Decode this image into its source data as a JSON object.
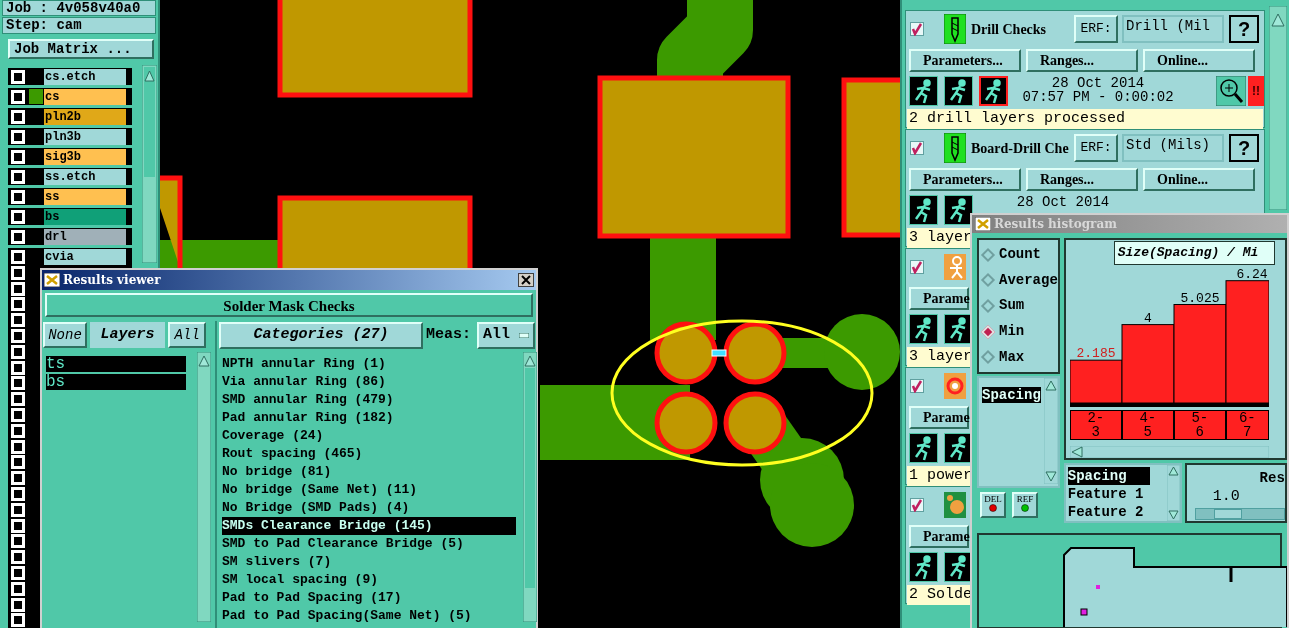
{
  "job_panel": {
    "job": "Job : 4v058v40a0",
    "step": "Step: cam",
    "matrix_button": "Job Matrix ...",
    "layers": [
      {
        "name": "cs.etch",
        "color": "#a0d8d8",
        "checked": false,
        "affected": false
      },
      {
        "name": "cs",
        "color": "#ffc050",
        "checked": false,
        "affected": true
      },
      {
        "name": "pln2b",
        "color": "#e0a818",
        "checked": false,
        "affected": false
      },
      {
        "name": "pln3b",
        "color": "#a0d8d8",
        "checked": false,
        "affected": false
      },
      {
        "name": "sig3b",
        "color": "#ffc050",
        "checked": false,
        "affected": false
      },
      {
        "name": "ss.etch",
        "color": "#a0d8d8",
        "checked": false,
        "affected": false
      },
      {
        "name": "ss",
        "color": "#ffc050",
        "checked": false,
        "affected": false
      },
      {
        "name": "bs",
        "color": "#10a078",
        "checked": false,
        "affected": false
      },
      {
        "name": "drl",
        "color": "#a0b0b8",
        "checked": false,
        "affected": false
      },
      {
        "name": "cvia",
        "color": "#a0d8d8",
        "checked": false,
        "affected": false
      }
    ],
    "empty_layers": [
      {
        "checked": false
      },
      {
        "checked": false
      },
      {
        "checked": false
      },
      {
        "checked": false
      },
      {
        "checked": false
      },
      {
        "checked": false
      },
      {
        "checked": false
      },
      {
        "checked": false
      },
      {
        "checked": false
      },
      {
        "checked": false
      },
      {
        "checked": false
      },
      {
        "checked": false
      },
      {
        "checked": false
      },
      {
        "checked": false
      },
      {
        "checked": false
      },
      {
        "checked": false
      },
      {
        "checked": false
      },
      {
        "checked": false
      },
      {
        "checked": false
      },
      {
        "checked": false
      },
      {
        "checked": false
      },
      {
        "checked": false
      },
      {
        "checked": false
      }
    ]
  },
  "checks_panel": {
    "checks": [
      {
        "enabled": true,
        "kind": "drill",
        "title": "Drill Checks",
        "erf_button": "ERF:",
        "erf_value": "Drill (Mil",
        "help_button": "?",
        "buttons": [
          "Parameters...",
          "Ranges...",
          "Online..."
        ],
        "date": "28 Oct 2014",
        "time": "07:57 PM - 0:00:02",
        "alert": "!!",
        "status": "2 drill layers processed"
      },
      {
        "enabled": true,
        "kind": "drill",
        "title": "Board-Drill Che",
        "erf_button": "ERF:",
        "erf_value": "Std (Mils)",
        "help_button": "?",
        "buttons": [
          "Parameters...",
          "Ranges...",
          "Online..."
        ],
        "date": "28 Oct 2014",
        "status": "3 layer"
      },
      {
        "enabled": true,
        "kind": "person",
        "buttons": [
          "Parame"
        ],
        "status": "3 layer"
      },
      {
        "enabled": true,
        "kind": "gear",
        "buttons": [
          "Parame"
        ],
        "status": "1 power"
      },
      {
        "enabled": true,
        "kind": "pads",
        "buttons": [
          "Parame"
        ],
        "status": "2 Solde"
      }
    ]
  },
  "results_viewer": {
    "title": "Results viewer",
    "check_set": "Solder Mask Checks",
    "layer_buttons": [
      "None",
      "Layers",
      "All"
    ],
    "layers": [
      {
        "name": "ts",
        "selected": true
      },
      {
        "name": "bs",
        "selected": true
      }
    ],
    "categories_button": "Categories (27)",
    "meas_label": "Meas:",
    "meas_value": "All",
    "categories": [
      {
        "label": "NPTH annular Ring (1)",
        "selected": false
      },
      {
        "label": "Via annular Ring (86)",
        "selected": false
      },
      {
        "label": "SMD annular Ring (479)",
        "selected": false
      },
      {
        "label": "Pad annular Ring (182)",
        "selected": false
      },
      {
        "label": "Coverage (24)",
        "selected": false
      },
      {
        "label": "Rout spacing (465)",
        "selected": false
      },
      {
        "label": "No bridge (81)",
        "selected": false
      },
      {
        "label": "No bridge (Same Net) (11)",
        "selected": false
      },
      {
        "label": "No Bridge (SMD Pads) (4)",
        "selected": false
      },
      {
        "label": "SMDs Clearance Bridge (145)",
        "selected": true
      },
      {
        "label": "SMD to Pad Clearance Bridge (5)",
        "selected": false
      },
      {
        "label": "SM slivers (7)",
        "selected": false
      },
      {
        "label": "SM local spacing (9)",
        "selected": false
      },
      {
        "label": "Pad to Pad Spacing (17)",
        "selected": false
      },
      {
        "label": "Pad to Pad Spacing(Same Net) (5)",
        "selected": false
      }
    ]
  },
  "histogram": {
    "title": "Results histogram",
    "modes": [
      {
        "label": "Count",
        "selected": false
      },
      {
        "label": "Average",
        "selected": false
      },
      {
        "label": "Sum",
        "selected": false
      },
      {
        "label": "Min",
        "selected": true
      },
      {
        "label": "Max",
        "selected": false
      }
    ],
    "measures": [
      {
        "label": "Spacing",
        "selected": true
      }
    ],
    "del_button": "DEL",
    "ref_button": "REF",
    "chart_data": {
      "type": "bar",
      "title": "Size(Spacing) / Mi",
      "categories": [
        "2-3",
        "4-5",
        "5-6",
        "6-7"
      ],
      "values": [
        2.185,
        4,
        5.025,
        6.24
      ],
      "data_labels": true
    },
    "features": [
      {
        "label": "Spacing",
        "selected": true
      },
      {
        "label": "Feature 1",
        "selected": false
      },
      {
        "label": "Feature 2",
        "selected": false
      }
    ],
    "resolution_label": "Res",
    "resolution_value": "1.0",
    "resolution": {
      "level": 0.3
    }
  }
}
